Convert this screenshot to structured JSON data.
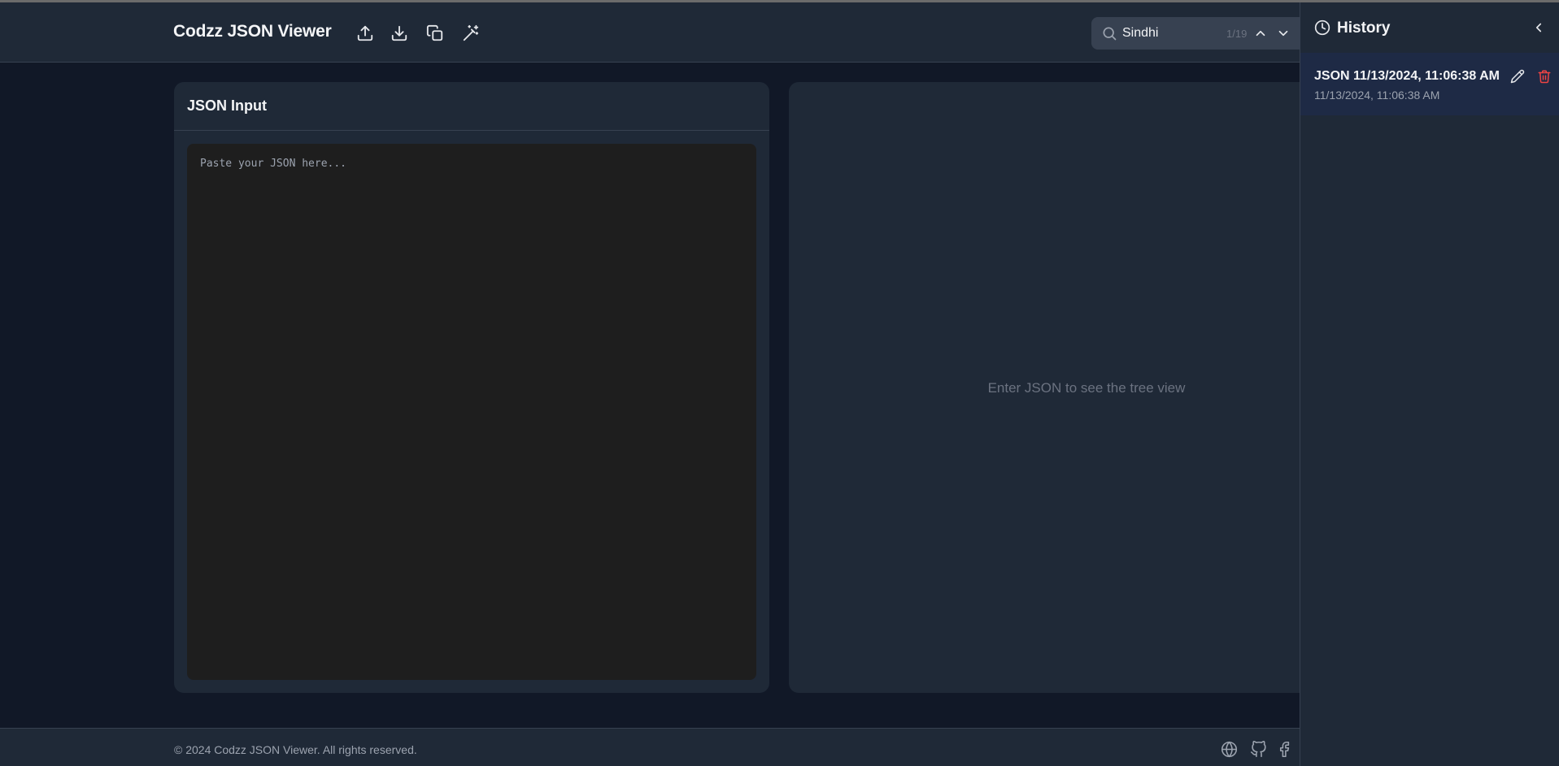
{
  "app": {
    "title": "Codzz JSON Viewer"
  },
  "toolbar": {
    "icons": [
      "upload-icon",
      "download-icon",
      "copy-icon",
      "magic-wand-icon"
    ]
  },
  "search": {
    "value": "Sindhi",
    "count": "1/19",
    "icons": [
      "search-icon",
      "chevron-up-icon",
      "chevron-down-icon"
    ]
  },
  "input_panel": {
    "title": "JSON Input",
    "placeholder": "Paste your JSON here..."
  },
  "tree_panel": {
    "placeholder": "Enter JSON to see the tree view"
  },
  "footer": {
    "copyright": "© 2024 Codzz JSON Viewer. All rights reserved.",
    "icons": [
      "globe-icon",
      "github-icon",
      "facebook-icon"
    ]
  },
  "history": {
    "title": "History",
    "items": [
      {
        "title": "JSON 11/13/2024, 11:06:38 AM",
        "date": "11/13/2024, 11:06:38 AM"
      }
    ]
  },
  "colors": {
    "background": "#111827",
    "panel": "#1f2937",
    "editor": "#1e1e1e",
    "history_item_active": "#1e2a45",
    "delete": "#ef4444"
  }
}
